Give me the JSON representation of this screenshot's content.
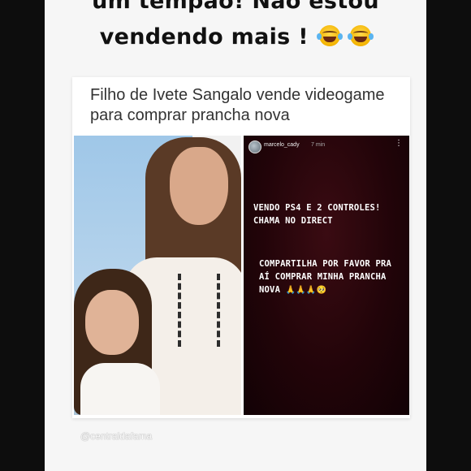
{
  "story": {
    "caption_line1": "um tempão! Não estou",
    "caption_line2": "vendendo mais !",
    "caption_emoji": "face-with-tears-of-joy-icon"
  },
  "news_card": {
    "headline": "Filho de Ivete Sangalo vende videogame para comprar prancha nova"
  },
  "instagram_story": {
    "username": "marcelo_cady",
    "time": "7 min",
    "more_icon": "more-vertical-icon",
    "text1": "VENDO PS4 E 2 CONTROLES! CHAMA NO DIRECT",
    "text2": "COMPARTILHA POR FAVOR PRA AÍ COMPRAR MINHA PRANCHA NOVA",
    "text2_emojis": "🙏🙏🙏🥺"
  },
  "watermark": "@centraldafama",
  "colors": {
    "page_background": "#0d0d0d",
    "story_background": "#f6f6f6",
    "ig_background": "#220409"
  }
}
